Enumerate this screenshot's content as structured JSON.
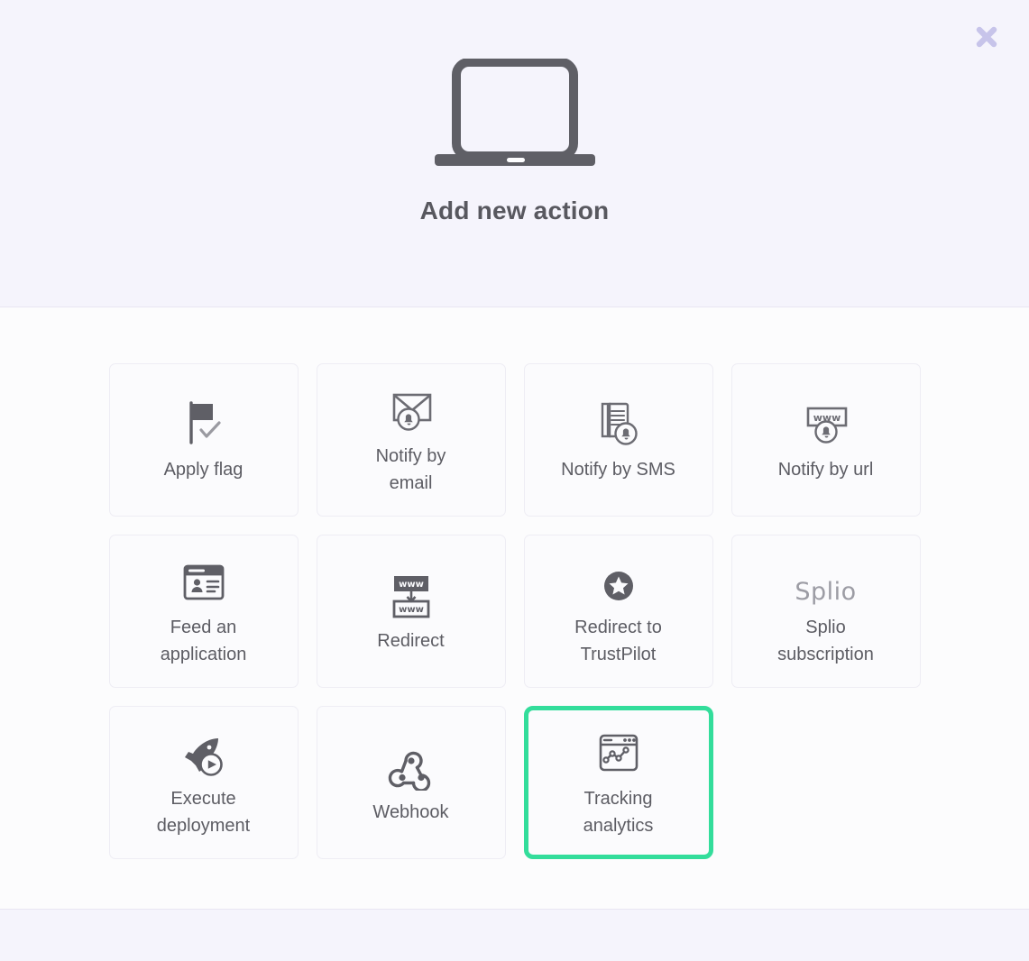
{
  "header": {
    "title": "Add new action",
    "icon": "laptop-icon",
    "close_label": "×",
    "close_icon": "close-icon",
    "close_color": "#c7c4ea"
  },
  "theme": {
    "header_background": "#f5f4fc",
    "body_background": "#fcfcfd",
    "selected_border": "#33dd9b",
    "card_background": "#fbfbfd",
    "card_border": "#eeedf4",
    "text_color": "#5c5c63",
    "title_color": "#58585f",
    "icon_color": "#5f5f66"
  },
  "actions": [
    {
      "id": "apply-flag",
      "label": "Apply flag",
      "icon": "flag-check-icon",
      "selected": false
    },
    {
      "id": "notify-by-email",
      "label": "Notify by\nemail",
      "icon": "envelope-bell-icon",
      "selected": false
    },
    {
      "id": "notify-by-sms",
      "label": "Notify by SMS",
      "icon": "phone-bell-icon",
      "selected": false
    },
    {
      "id": "notify-by-url",
      "label": "Notify by url",
      "icon": "www-bell-icon",
      "selected": false
    },
    {
      "id": "feed-an-application",
      "label": "Feed an\napplication",
      "icon": "browser-profile-icon",
      "selected": false
    },
    {
      "id": "redirect",
      "label": "Redirect",
      "icon": "www-redirect-icon",
      "selected": false
    },
    {
      "id": "redirect-trustpilot",
      "label": "Redirect to\nTrustPilot",
      "icon": "star-circle-icon",
      "selected": false
    },
    {
      "id": "splio-subscription",
      "label": "Splio\nsubscription",
      "icon": "splio-logo",
      "logo_text": "Splio",
      "selected": false
    },
    {
      "id": "execute-deployment",
      "label": "Execute\ndeployment",
      "icon": "rocket-play-icon",
      "selected": false
    },
    {
      "id": "webhook",
      "label": "Webhook",
      "icon": "webhook-icon",
      "selected": false
    },
    {
      "id": "tracking-analytics",
      "label": "Tracking\nanalytics",
      "icon": "browser-chart-icon",
      "selected": true
    }
  ]
}
